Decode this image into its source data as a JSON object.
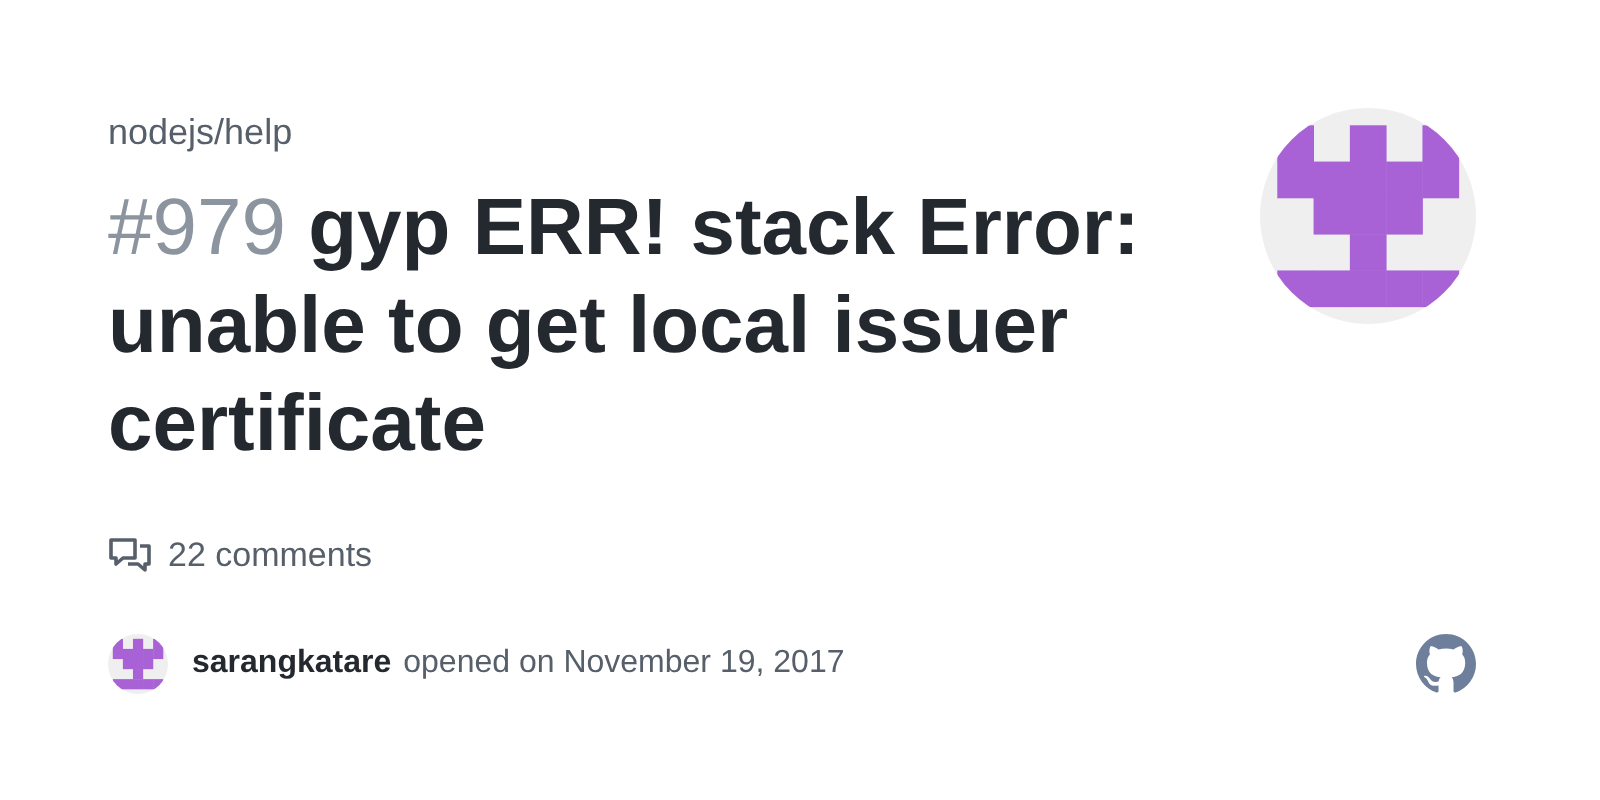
{
  "repo": "nodejs/help",
  "issue": {
    "number": "#979",
    "title": "gyp ERR! stack Error: unable to get local issuer certificate"
  },
  "comments": "22 comments",
  "author": {
    "name": "sarangkatare",
    "action": "opened on November 19, 2017"
  }
}
